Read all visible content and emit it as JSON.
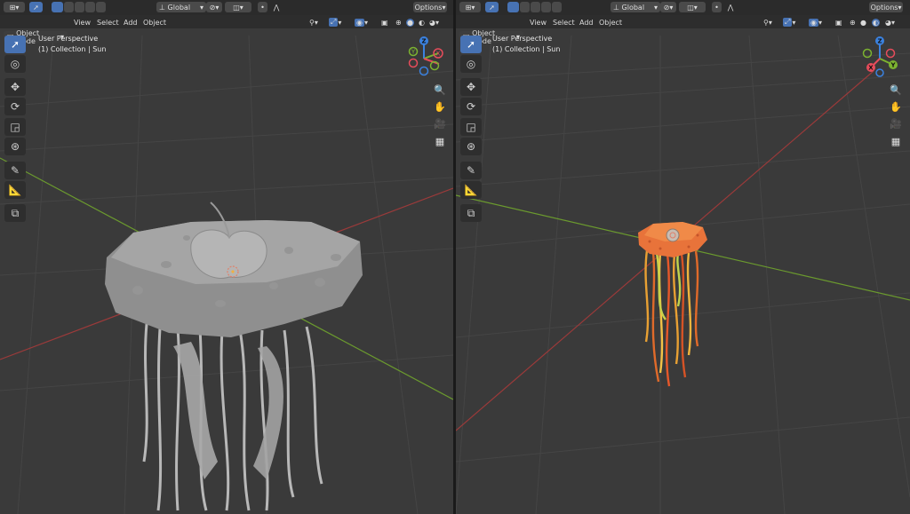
{
  "left_viewport": {
    "header": {
      "transform": "Global",
      "options": "Options"
    },
    "mode": "Object Mode",
    "menus": [
      "View",
      "Select",
      "Add",
      "Object"
    ],
    "overlay_line1": "User Perspective",
    "overlay_line2": "(1) Collection | Sun",
    "gizmo": {
      "z": "Z",
      "y": "Y",
      "x": "X"
    }
  },
  "right_viewport": {
    "header": {
      "transform": "Global",
      "options": "Options"
    },
    "mode": "Object Mode",
    "menus": [
      "View",
      "Select",
      "Add",
      "Object"
    ],
    "overlay_line1": "User Perspective",
    "overlay_line2": "(1) Collection | Sun",
    "gizmo": {
      "z": "Z",
      "y": "Y",
      "x": "X"
    }
  },
  "tools": [
    "select-box-icon",
    "cursor-icon",
    "move-icon",
    "rotate-icon",
    "scale-icon",
    "transform-icon",
    "annotate-icon",
    "measure-icon",
    "add-cube-icon"
  ],
  "nav_icons": [
    "zoom-icon",
    "pan-hand-icon",
    "camera-icon",
    "grid-view-icon"
  ],
  "colors": {
    "viewport_bg": "#3a3a3a",
    "header_bg": "#2b2b2b",
    "selected_blue": "#4772b3",
    "x_axis": "#9b3a3a",
    "y_axis": "#6b9a2e",
    "gizmo_x": "#e74c5b",
    "gizmo_y": "#7cb330",
    "gizmo_z": "#3b82e0",
    "jelly_orange": "#e8733a"
  }
}
